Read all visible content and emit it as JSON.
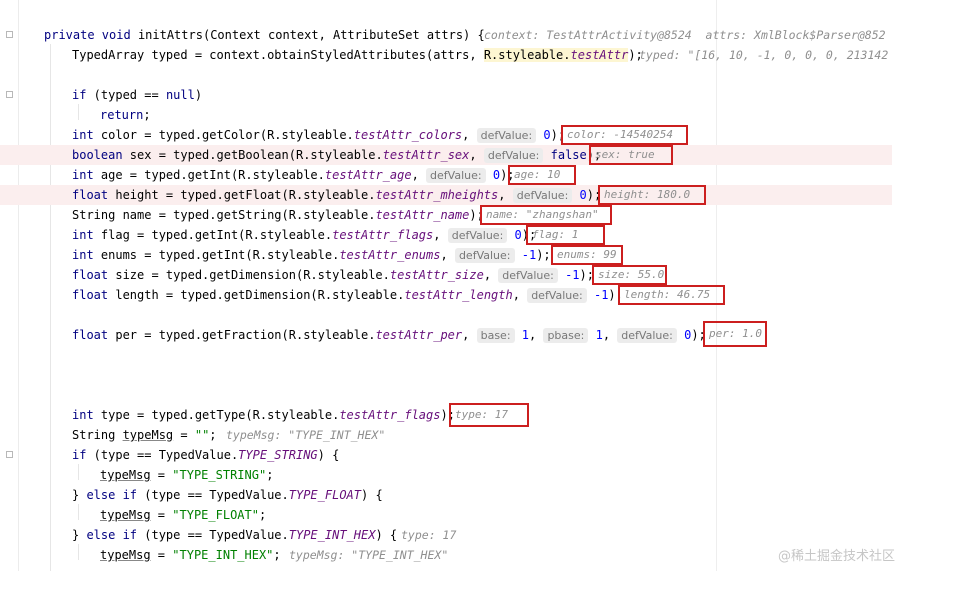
{
  "signature": {
    "modifiers": "private void",
    "method_name": "initAttrs",
    "params": "(Context context, AttributeSet attrs) {",
    "debug": "context: TestAttrActivity@8524  attrs: XmlBlock$Parser@852"
  },
  "typed_decl": {
    "code": "TypedArray typed = context.obtainStyledAttributes(attrs, ",
    "highlight": "R.styleable.",
    "field": "testAttr",
    "tail": ");",
    "debug": "typed: \"[16, 10, -1, 0, 0, 0, 213142"
  },
  "null_check": {
    "if_kw": "if",
    "cond_a": " (typed == ",
    "null_kw": "null",
    "cond_b": ")",
    "return_kw": "return",
    "return_tail": ";"
  },
  "get_calls": [
    {
      "type": "int",
      "var": " color = typed.getColor(R.styleable.",
      "field": "testAttr_colors",
      "sep": ",",
      "hint": "defValue:",
      "arg": "0",
      "close": ");",
      "debug": "color: -14540254"
    },
    {
      "type": "boolean",
      "var": " sex = typed.getBoolean(R.styleable.",
      "field": "testAttr_sex",
      "sep": ",",
      "hint": "defValue:",
      "arg": "false",
      "close": ");",
      "debug": "sex: true"
    },
    {
      "type": "int",
      "var": " age = typed.getInt(R.styleable.",
      "field": "testAttr_age",
      "sep": ",",
      "hint": "defValue:",
      "arg": "0",
      "close": ");",
      "debug": "age: 10"
    },
    {
      "type": "float",
      "var": " height = typed.getFloat(R.styleable.",
      "field": "testAttr_mheights",
      "sep": ",",
      "hint": "defValue:",
      "arg": "0",
      "close": ");",
      "debug": "height: 180.0"
    },
    {
      "type": "String",
      "var": " name = typed.getString(R.styleable.",
      "field": "testAttr_name",
      "sep": "",
      "hint": "",
      "arg": "",
      "close": ");",
      "debug": "name: \"zhangshan\""
    },
    {
      "type": "int",
      "var": " flag = typed.getInt(R.styleable.",
      "field": "testAttr_flags",
      "sep": ",",
      "hint": "defValue:",
      "arg": "0",
      "close": ");",
      "debug": "flag: 1"
    },
    {
      "type": "int",
      "var": " enums = typed.getInt(R.styleable.",
      "field": "testAttr_enums",
      "sep": ",",
      "hint": "defValue:",
      "arg": "-1",
      "close": ");",
      "debug": "enums: 99"
    },
    {
      "type": "float",
      "var": " size = typed.getDimension(R.styleable.",
      "field": "testAttr_size",
      "sep": ",",
      "hint": "defValue:",
      "arg": "-1",
      "close": ");",
      "debug": "size: 55.0"
    },
    {
      "type": "float",
      "var": " length = typed.getDimension(R.styleable.",
      "field": "testAttr_length",
      "sep": ",",
      "hint": "defValue:",
      "arg": "-1",
      "close": ");",
      "debug": "length: 46.75"
    }
  ],
  "fraction": {
    "type": "float",
    "var": " per = typed.getFraction(R.styleable.",
    "field": "testAttr_per",
    "hint_base": "base:",
    "val_base": "1",
    "hint_pbase": "pbase:",
    "val_pbase": "1",
    "hint_def": "defValue:",
    "val_def": "0",
    "close": ");",
    "debug": "per: 1.0"
  },
  "type_call": {
    "type": "int",
    "var": " type = typed.getType(R.styleable.",
    "field": "testAttr_flags",
    "close": ");",
    "debug": "type: 17"
  },
  "type_msg": {
    "decl_a": "String ",
    "var": "typeMsg",
    "decl_b": " = ",
    "str": "\"\"",
    "semi": ";",
    "debug": "typeMsg: \"TYPE_INT_HEX\""
  },
  "branches": [
    {
      "prefix": "",
      "kw": "if",
      "cond": " (type == TypedValue.",
      "const": "TYPE_STRING",
      "tail": ") {",
      "debug": "",
      "assign_var": "typeMsg",
      "assign_eq": " = ",
      "assign_str": "\"TYPE_STRING\"",
      "assign_semi": ";",
      "assign_debug": ""
    },
    {
      "prefix": "} ",
      "kw": "else if",
      "cond": " (type == TypedValue.",
      "const": "TYPE_FLOAT",
      "tail": ") {",
      "debug": "",
      "assign_var": "typeMsg",
      "assign_eq": " = ",
      "assign_str": "\"TYPE_FLOAT\"",
      "assign_semi": ";",
      "assign_debug": ""
    },
    {
      "prefix": "} ",
      "kw": "else if",
      "cond": " (type == TypedValue.",
      "const": "TYPE_INT_HEX",
      "tail": ") {",
      "debug": "type: 17",
      "assign_var": "typeMsg",
      "assign_eq": " = ",
      "assign_str": "\"TYPE_INT_HEX\"",
      "assign_semi": ";",
      "assign_debug": "typeMsg: \"TYPE_INT_HEX\""
    }
  ],
  "watermark": "@稀土掘金技术社区",
  "colors": {
    "keyword": "#000080",
    "field": "#660e7a",
    "string": "#008000",
    "number": "#0000ff",
    "debug_text": "#8f8f8f",
    "annotation_box": "#cc1f1f",
    "highlight_row": "#fbeeee"
  }
}
